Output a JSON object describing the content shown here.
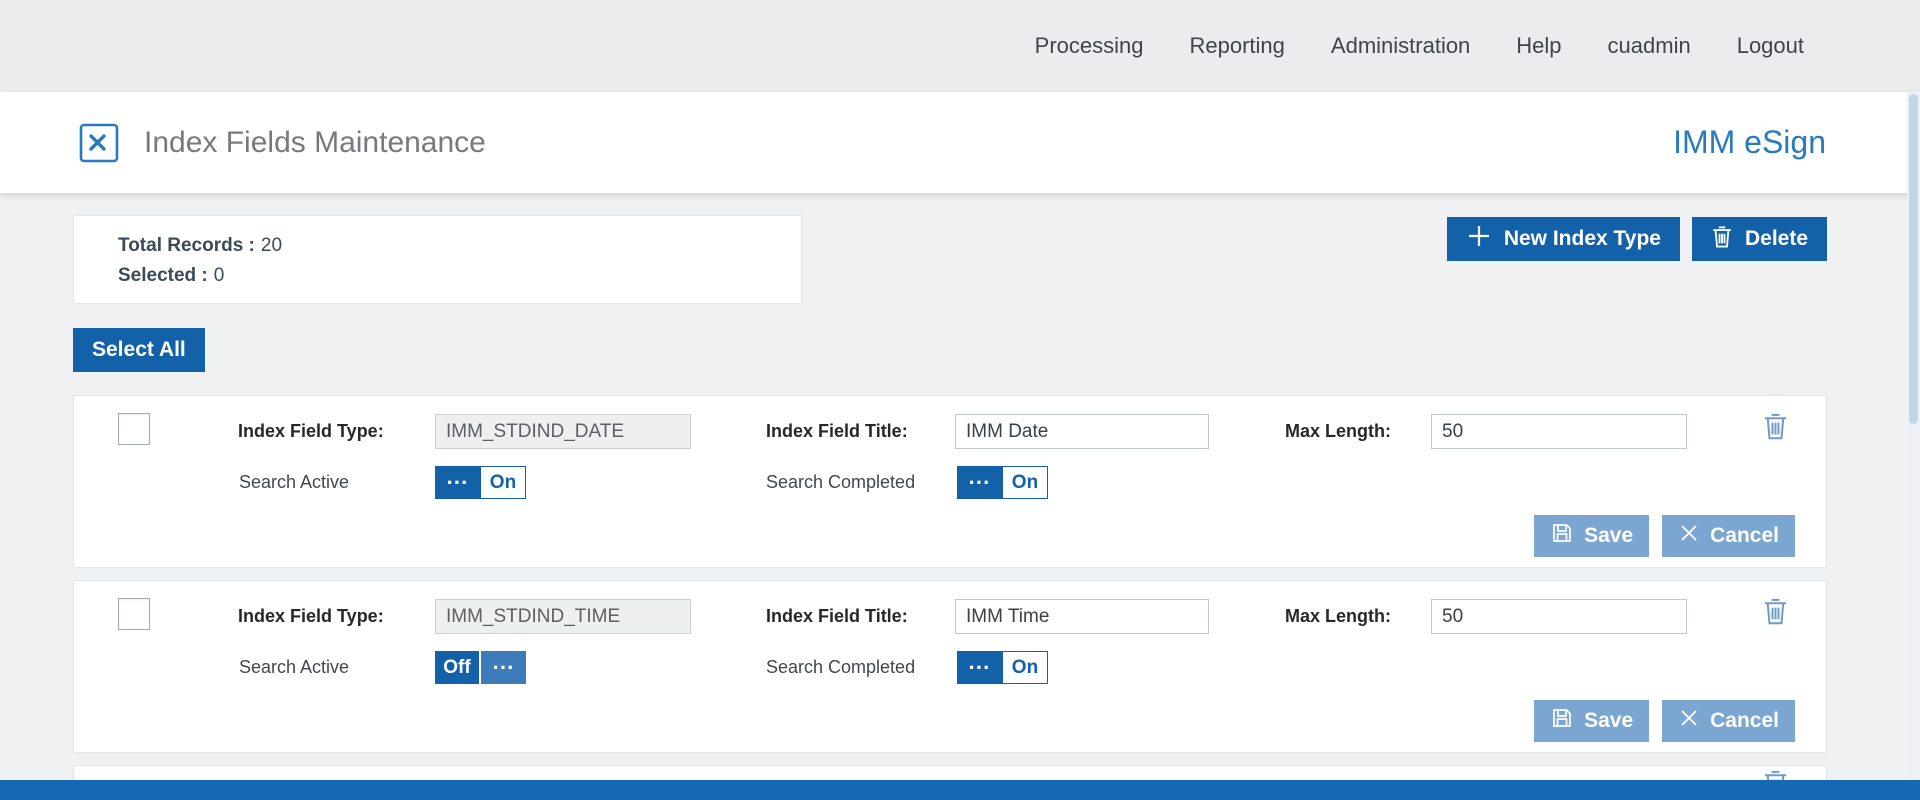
{
  "nav": {
    "items": [
      "Processing",
      "Reporting",
      "Administration",
      "Help",
      "cuadmin",
      "Logout"
    ]
  },
  "header": {
    "title": "Index Fields Maintenance",
    "brand": "IMM eSign"
  },
  "summary": {
    "total_label": "Total Records :",
    "total_value": "20",
    "selected_label": "Selected :",
    "selected_value": "0"
  },
  "toolbar": {
    "new_index_type_label": "New Index Type",
    "delete_label": "Delete",
    "select_all_label": "Select All"
  },
  "row_labels": {
    "field_type": "Index Field Type:",
    "field_title": "Index Field Title:",
    "max_length": "Max Length:",
    "search_active": "Search Active",
    "search_completed": "Search Completed",
    "save": "Save",
    "cancel": "Cancel",
    "handle": "···"
  },
  "rows": [
    {
      "field_type": "IMM_STDIND_DATE",
      "field_title": "IMM Date",
      "max_length": "50",
      "search_active_state": "On",
      "search_completed_state": "On"
    },
    {
      "field_type": "IMM_STDIND_TIME",
      "field_title": "IMM Time",
      "max_length": "50",
      "search_active_state": "Off",
      "search_completed_state": "On"
    }
  ],
  "colors": {
    "accent_blue": "#1362a9",
    "muted_button_blue": "#7ca6d2",
    "brand_blue": "#2a7abf",
    "bottom_bar_blue": "#1569b4"
  }
}
